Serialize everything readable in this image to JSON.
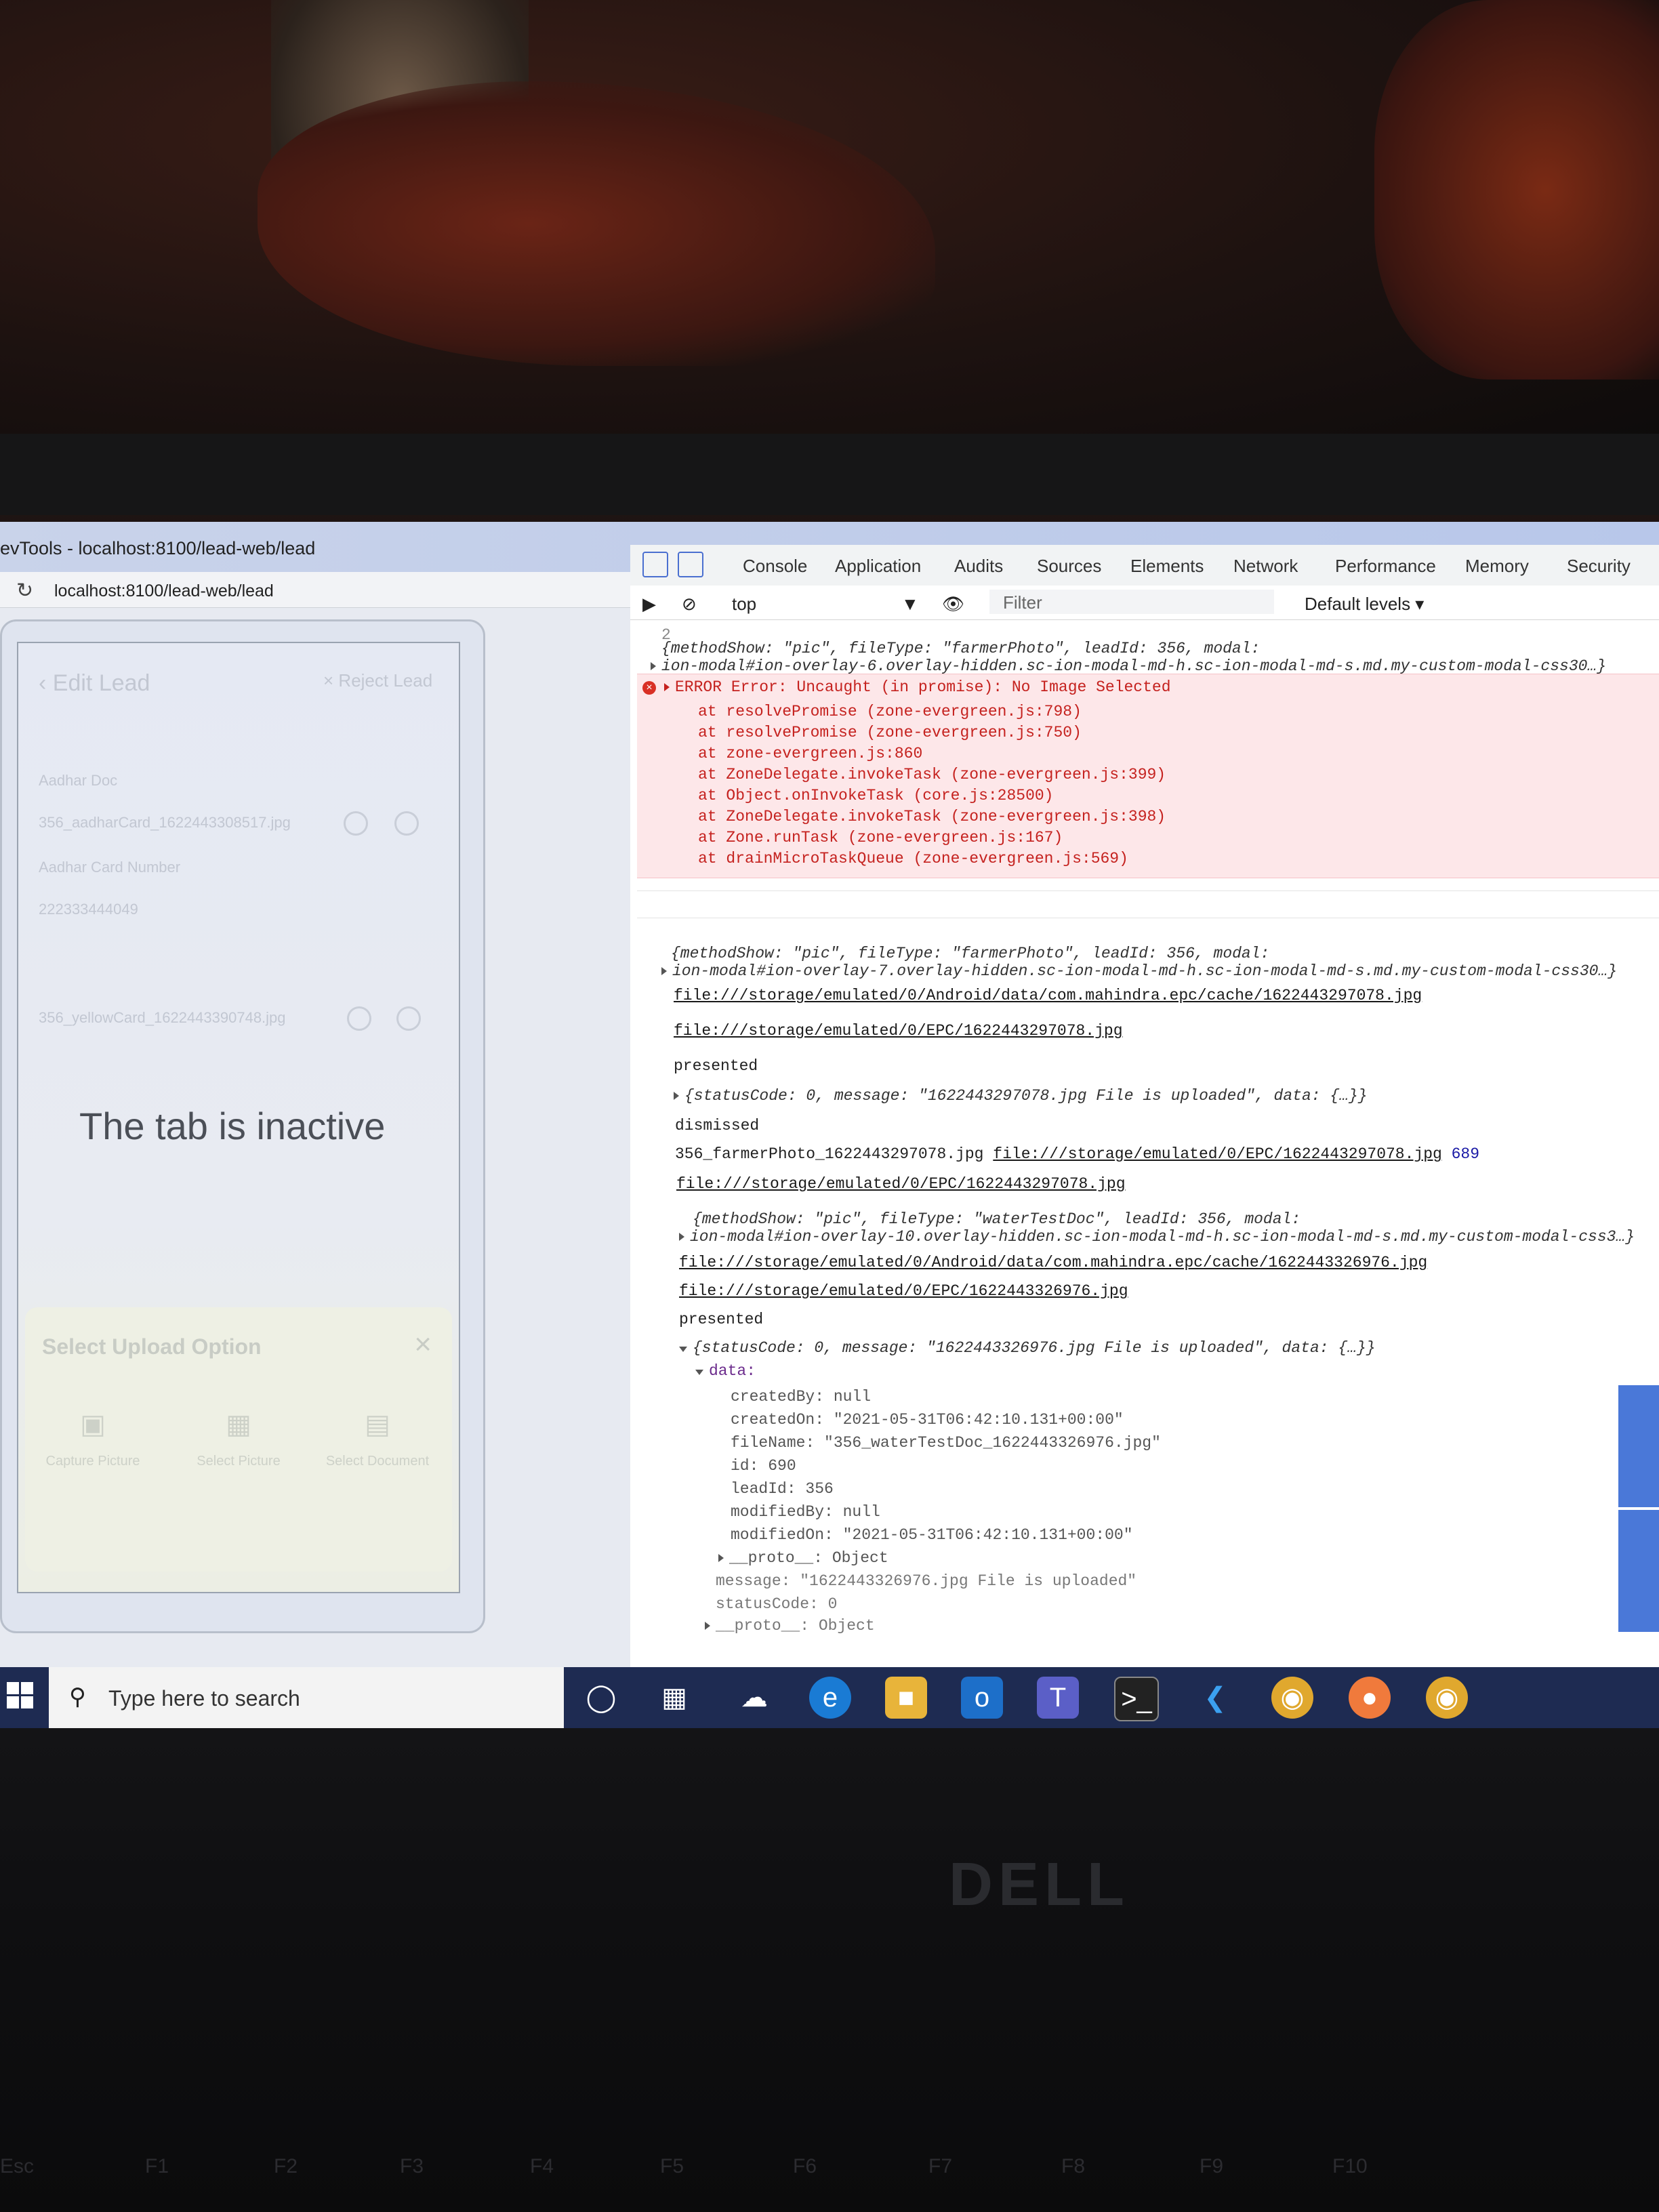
{
  "window": {
    "title": "evTools - localhost:8100/lead-web/lead"
  },
  "browser": {
    "url": "localhost:8100/lead-web/lead"
  },
  "app": {
    "header": {
      "title": "Edit Lead",
      "reject": "Reject Lead"
    },
    "fields": {
      "aadhar_doc_label": "Aadhar Doc",
      "aadhar_file": "356_aadharCard_1622443308517.jpg",
      "aadhar_number_label": "Aadhar Card Number",
      "aadhar_number_value": "222333444049",
      "second_file": "356_yellowCard_1622443390748.jpg"
    },
    "inactive_message": "The tab is inactive",
    "modal": {
      "title": "Select Upload Option",
      "options": [
        "Capture Picture",
        "Select Picture",
        "Select Document"
      ]
    }
  },
  "devtools": {
    "tabs": [
      "Console",
      "Application",
      "Audits",
      "Sources",
      "Elements",
      "Network",
      "Performance",
      "Memory",
      "Security"
    ],
    "context": "top",
    "filter_placeholder": "Filter",
    "levels": "Default levels ▾",
    "log": {
      "top_number": "2",
      "obj1_line1": "{methodShow: \"pic\", fileType: \"farmerPhoto\", leadId: 356, modal:",
      "obj1_line2": "ion-modal#ion-overlay-6.overlay-hidden.sc-ion-modal-md-h.sc-ion-modal-md-s.md.my-custom-modal-css30…}",
      "error_title": "ERROR Error: Uncaught (in promise): No Image Selected",
      "stack": [
        "at resolvePromise (zone-evergreen.js:798)",
        "at resolvePromise (zone-evergreen.js:750)",
        "at zone-evergreen.js:860",
        "at ZoneDelegate.invokeTask (zone-evergreen.js:399)",
        "at Object.onInvokeTask (core.js:28500)",
        "at ZoneDelegate.invokeTask (zone-evergreen.js:398)",
        "at Zone.runTask (zone-evergreen.js:167)",
        "at drainMicroTaskQueue (zone-evergreen.js:569)"
      ],
      "obj2_line1": "{methodShow: \"pic\", fileType: \"farmerPhoto\", leadId: 356, modal:",
      "obj2_line2": "ion-modal#ion-overlay-7.overlay-hidden.sc-ion-modal-md-h.sc-ion-modal-md-s.md.my-custom-modal-css30…}",
      "path1": "file:///storage/emulated/0/Android/data/com.mahindra.epc/cache/1622443297078.jpg",
      "path2": "file:///storage/emulated/0/EPC/1622443297078.jpg",
      "presented1": "presented",
      "status1": "{statusCode: 0, message: \"1622443297078.jpg File is uploaded\", data: {…}}",
      "dismissed": "dismissed",
      "farmer_name": "356_farmerPhoto_1622443297078.jpg",
      "farmer_path": "file:///storage/emulated/0/EPC/1622443297078.jpg",
      "farmer_id": "689",
      "path3": "file:///storage/emulated/0/EPC/1622443297078.jpg",
      "obj3_line1": "{methodShow: \"pic\", fileType: \"waterTestDoc\", leadId: 356, modal:",
      "obj3_line2": "ion-modal#ion-overlay-10.overlay-hidden.sc-ion-modal-md-h.sc-ion-modal-md-s.md.my-custom-modal-css3…}",
      "path4": "file:///storage/emulated/0/Android/data/com.mahindra.epc/cache/1622443326976.jpg",
      "path5": "file:///storage/emulated/0/EPC/1622443326976.jpg",
      "presented2": "presented",
      "status2": "{statusCode: 0, message: \"1622443326976.jpg File is uploaded\", data: {…}}",
      "data_label": "data:",
      "createdBy": "createdBy: null",
      "createdOn": "createdOn: \"2021-05-31T06:42:10.131+00:00\"",
      "fileName": "fileName: \"356_waterTestDoc_1622443326976.jpg\"",
      "id": "id: 690",
      "leadId": "leadId: 356",
      "modifiedBy": "modifiedBy: null",
      "modifiedOn": "modifiedOn: \"2021-05-31T06:42:10.131+00:00\"",
      "proto1": "__proto__: Object",
      "message": "message: \"1622443326976.jpg File is uploaded\"",
      "statusCode": "statusCode: 0",
      "proto2": "__proto__: Object"
    }
  },
  "taskbar": {
    "search_placeholder": "Type here to search",
    "icons": [
      "cortana-icon",
      "task-view-icon",
      "weather-icon",
      "edge-icon",
      "file-explorer-icon",
      "outlook-icon",
      "teams-icon",
      "terminal-icon",
      "vscode-icon",
      "chrome-icon",
      "postman-icon",
      "chrome-icon"
    ]
  },
  "laptop": {
    "brand": "DELL",
    "keys": [
      "Esc",
      "F1",
      "F2",
      "F3",
      "F4",
      "F5",
      "F6",
      "F7",
      "F8",
      "F9",
      "F10"
    ]
  },
  "colors": {
    "error_bg": "#fde7e9",
    "error_text": "#c5221f",
    "taskbar": "#1e2b52"
  }
}
